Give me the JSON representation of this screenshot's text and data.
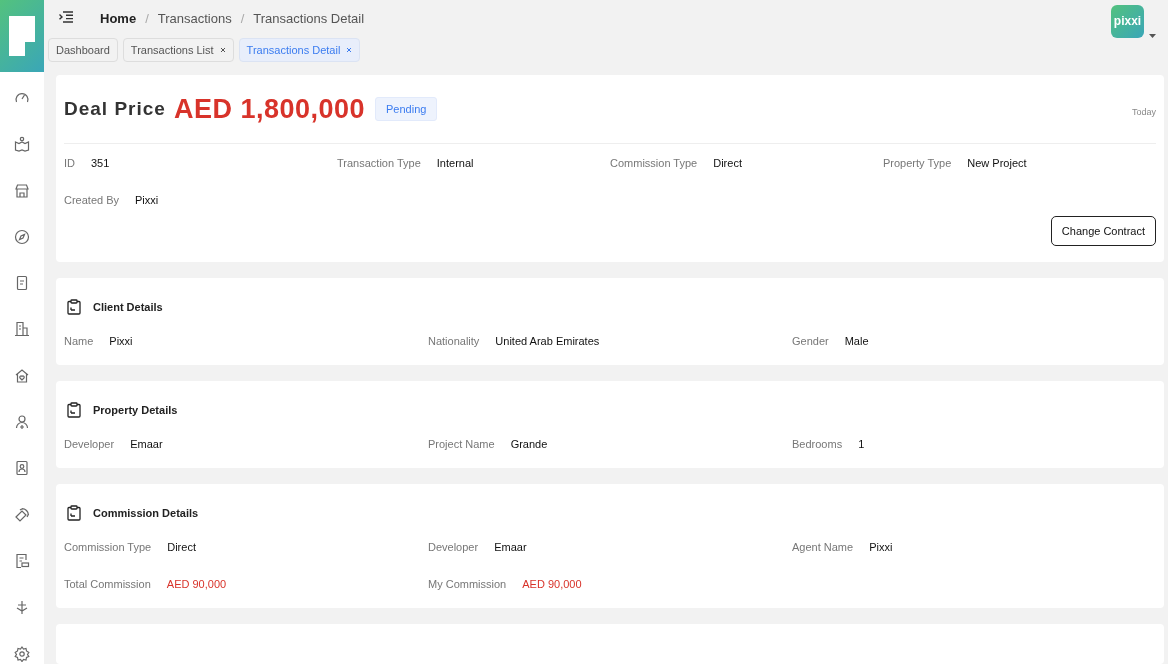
{
  "header": {
    "breadcrumb": [
      "Home",
      "Transactions",
      "Transactions Detail"
    ],
    "separator": "/",
    "avatar": "pixxi"
  },
  "tabs": [
    {
      "label": "Dashboard",
      "closable": false,
      "selected": false
    },
    {
      "label": "Transactions List",
      "closable": true,
      "selected": false
    },
    {
      "label": "Transactions Detail",
      "closable": true,
      "selected": true
    }
  ],
  "deal": {
    "label": "Deal Price",
    "price": "AED 1,800,000",
    "status": "Pending",
    "date": "Today",
    "fields": [
      {
        "label": "ID",
        "value": "351"
      },
      {
        "label": "Transaction Type",
        "value": "Internal"
      },
      {
        "label": "Commission Type",
        "value": "Direct"
      },
      {
        "label": "Property Type",
        "value": "New Project"
      },
      {
        "label": "Created By",
        "value": "Pixxi"
      }
    ],
    "button": "Change Contract"
  },
  "sections": [
    {
      "title": "Client Details",
      "fields": [
        {
          "label": "Name",
          "value": "Pixxi",
          "kind": "text"
        },
        {
          "label": "Nationality",
          "value": "United Arab Emirates",
          "kind": "text"
        },
        {
          "label": "Gender",
          "value": "Male",
          "kind": "text"
        }
      ]
    },
    {
      "title": "Property Details",
      "fields": [
        {
          "label": "Developer",
          "value": "Emaar",
          "kind": "text"
        },
        {
          "label": "Project Name",
          "value": "Grande",
          "kind": "text"
        },
        {
          "label": "Bedrooms",
          "value": "1",
          "kind": "text"
        }
      ]
    },
    {
      "title": "Commission Details",
      "fields": [
        {
          "label": "Commission Type",
          "value": "Direct",
          "kind": "text"
        },
        {
          "label": "Developer",
          "value": "Emaar",
          "kind": "text"
        },
        {
          "label": "Agent Name",
          "value": "Pixxi",
          "kind": "text"
        },
        {
          "label": "Total Commission",
          "value": "AED 90,000",
          "kind": "money"
        },
        {
          "label": "My Commission",
          "value": "AED 90,000",
          "kind": "money"
        }
      ]
    }
  ]
}
